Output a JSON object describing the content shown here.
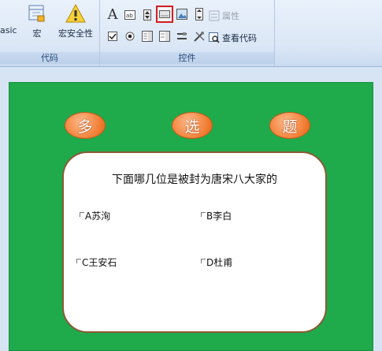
{
  "ribbon": {
    "code_group": {
      "label": "代码",
      "basic_label": "Basic",
      "macro_label": "宏",
      "macro_security_label": "宏安全性"
    },
    "controls_group": {
      "label": "控件",
      "properties_label": "属性",
      "view_code_label": "查看代码"
    },
    "selected_control": "command-button-icon"
  },
  "slide": {
    "title_chars": [
      "多",
      "选",
      "题"
    ],
    "question": "下面哪几位是被封为唐宋八大家的",
    "options": [
      {
        "label": "A苏洵"
      },
      {
        "label": "B李白"
      },
      {
        "label": "C王安石"
      },
      {
        "label": "D杜甫"
      }
    ],
    "colors": {
      "background": "#1faa4c",
      "bubble": "#f07b30",
      "card_border": "#8c5a34"
    }
  }
}
